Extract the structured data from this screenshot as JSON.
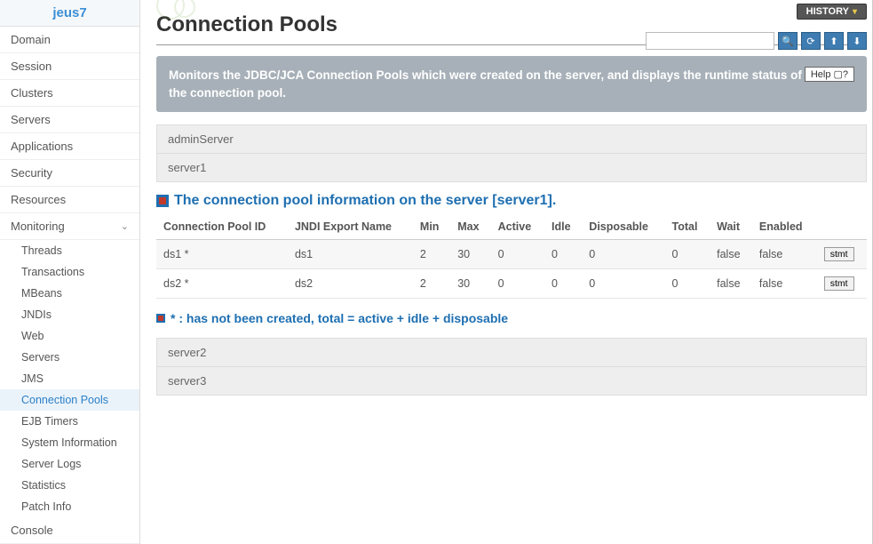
{
  "brand": "jeus7",
  "topbar": {
    "history": "HISTORY"
  },
  "search": {
    "placeholder": ""
  },
  "page": {
    "title": "Connection Pools",
    "banner": "Monitors the JDBC/JCA Connection Pools which were created on the server, and displays the runtime status of the connection pool.",
    "help": "Help"
  },
  "sidebar": {
    "items": [
      {
        "label": "Domain"
      },
      {
        "label": "Session"
      },
      {
        "label": "Clusters"
      },
      {
        "label": "Servers"
      },
      {
        "label": "Applications"
      },
      {
        "label": "Security"
      },
      {
        "label": "Resources"
      },
      {
        "label": "Monitoring"
      }
    ],
    "monitoring_children": [
      {
        "label": "Threads"
      },
      {
        "label": "Transactions"
      },
      {
        "label": "MBeans"
      },
      {
        "label": "JNDIs"
      },
      {
        "label": "Web"
      },
      {
        "label": "Servers"
      },
      {
        "label": "JMS"
      },
      {
        "label": "Connection Pools"
      },
      {
        "label": "EJB Timers"
      },
      {
        "label": "System Information"
      },
      {
        "label": "Server Logs"
      },
      {
        "label": "Statistics"
      },
      {
        "label": "Patch Info"
      }
    ],
    "console": "Console"
  },
  "servers": {
    "header1": "adminServer",
    "selected": "server1",
    "header2": "server2",
    "header3": "server3"
  },
  "section": {
    "title": "The connection pool information on the server [server1].",
    "footnote": "* : has not been created, total = active + idle + disposable"
  },
  "table": {
    "cols": [
      "Connection Pool ID",
      "JNDI Export Name",
      "Min",
      "Max",
      "Active",
      "Idle",
      "Disposable",
      "Total",
      "Wait",
      "Enabled",
      ""
    ],
    "rows": [
      {
        "id": "ds1 *",
        "jndi": "ds1",
        "min": "2",
        "max": "30",
        "active": "0",
        "idle": "0",
        "disposable": "0",
        "total": "0",
        "wait": "false",
        "enabled": "false",
        "btn": "stmt"
      },
      {
        "id": "ds2 *",
        "jndi": "ds2",
        "min": "2",
        "max": "30",
        "active": "0",
        "idle": "0",
        "disposable": "0",
        "total": "0",
        "wait": "false",
        "enabled": "false",
        "btn": "stmt"
      }
    ]
  }
}
